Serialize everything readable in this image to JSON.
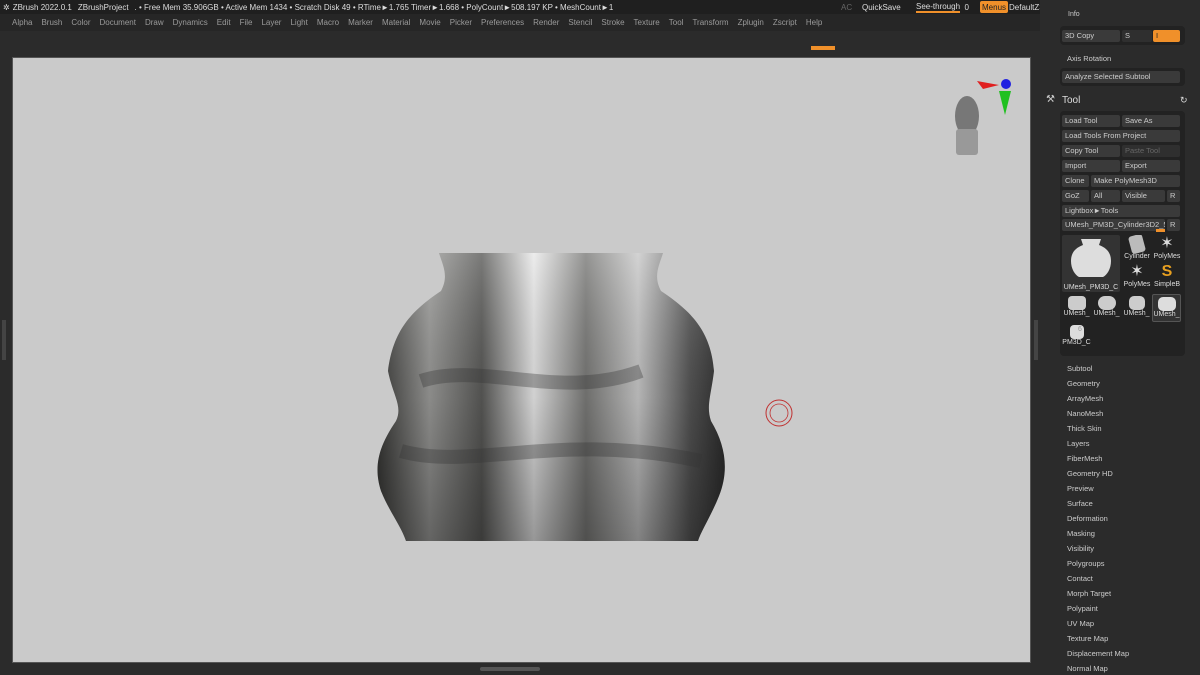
{
  "title": {
    "app": "ZBrush 2022.0.1",
    "project": "ZBrushProject",
    "stats": ". • Free Mem 35.906GB • Active Mem 1434 • Scratch Disk 49 • RTime►1.765 Timer►1.668 • PolyCount►508.197 KP • MeshCount►1"
  },
  "topright": {
    "ac": "AC",
    "quicksave": "QuickSave",
    "seethrough": "See-through",
    "seethrough_value": "0",
    "menus": "Menus",
    "script": "DefaultZScript"
  },
  "menu": [
    "Alpha",
    "Brush",
    "Color",
    "Document",
    "Draw",
    "Dynamics",
    "Edit",
    "File",
    "Layer",
    "Light",
    "Macro",
    "Marker",
    "Material",
    "Movie",
    "Picker",
    "Preferences",
    "Render",
    "Stencil",
    "Stroke",
    "Texture",
    "Tool",
    "Transform",
    "Zplugin",
    "Zscript",
    "Help"
  ],
  "panel": {
    "info": "Info",
    "copy3d": "3D Copy",
    "s": "S",
    "i": "I",
    "axis": "Axis Rotation",
    "analyze": "Analyze Selected Subtool",
    "tool_title": "Tool",
    "buttons": {
      "load": "Load Tool",
      "saveas": "Save As",
      "loadproj": "Load Tools From Project",
      "copy": "Copy Tool",
      "paste": "Paste Tool",
      "import": "Import",
      "export": "Export",
      "clone": "Clone",
      "make": "Make PolyMesh3D",
      "goz": "GoZ",
      "all": "All",
      "visible": "Visible",
      "r": "R",
      "lightbox": "Lightbox►Tools",
      "current": "UMesh_PM3D_Cylinder3D2_5"
    },
    "thumbs": [
      "UMesh_PM3D_C",
      "Cylinder",
      "PolyMes",
      "PolyMes",
      "SimpleB",
      "UMesh_",
      "UMesh_",
      "UMesh_",
      "UMesh_",
      "PM3D_C"
    ],
    "thumb_badge": "6",
    "subpalettes": [
      "Subtool",
      "Geometry",
      "ArrayMesh",
      "NanoMesh",
      "Thick Skin",
      "Layers",
      "FiberMesh",
      "Geometry HD",
      "Preview",
      "Surface",
      "Deformation",
      "Masking",
      "Visibility",
      "Polygroups",
      "Contact",
      "Morph Target",
      "Polypaint",
      "UV Map",
      "Texture Map",
      "Displacement Map",
      "Normal Map"
    ]
  },
  "colors": {
    "accent": "#f0902a",
    "canvas": "#cacaca"
  }
}
